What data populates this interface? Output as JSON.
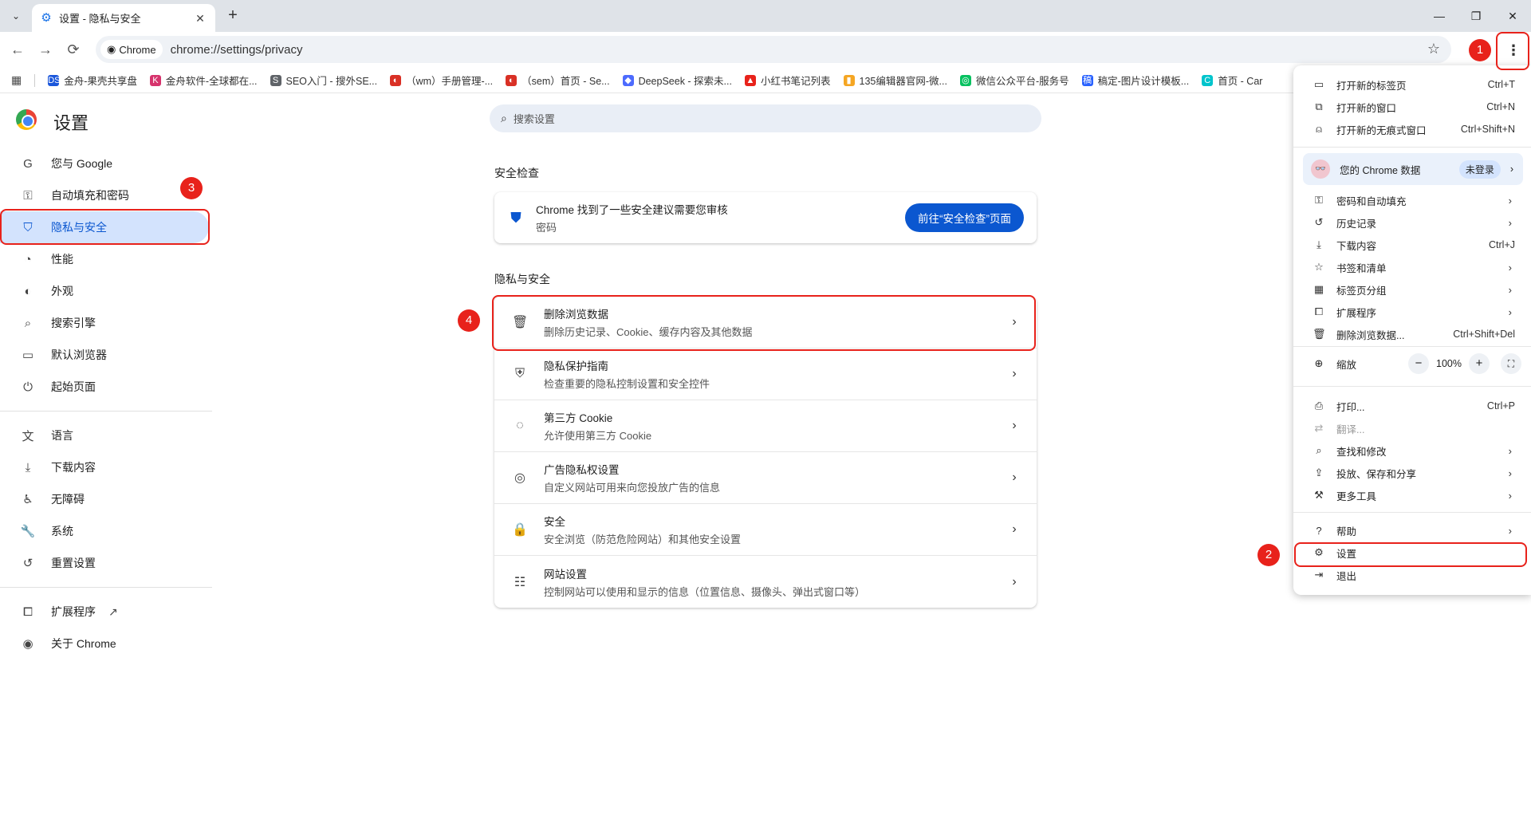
{
  "tab": {
    "title": "设置 - 隐私与安全",
    "close": "✕"
  },
  "window": {
    "minimize": "—",
    "restore": "❐",
    "close": "✕"
  },
  "toolbar": {
    "back": "←",
    "forward": "→",
    "reload": "⟳",
    "chip_label": "Chrome",
    "url": "chrome://settings/privacy",
    "star": "☆",
    "menu": "⋮"
  },
  "bookmarks": [
    {
      "label": "金舟-果壳共享盘",
      "icon": "DSK",
      "color": "#1a56db"
    },
    {
      "label": "金舟软件-全球都在...",
      "icon": "K",
      "color": "#d6336c"
    },
    {
      "label": "SEO入门 - 搜外SE...",
      "icon": "S",
      "color": "#5f6368"
    },
    {
      "label": "（wm）手册管理-...",
      "icon": "◐",
      "color": "#d93025"
    },
    {
      "label": "（sem）首页 - Se...",
      "icon": "◐",
      "color": "#d93025"
    },
    {
      "label": "DeepSeek - 探索未...",
      "icon": "◆",
      "color": "#4d6bfe"
    },
    {
      "label": "小红书笔记列表",
      "icon": "▲",
      "color": "#e8221b"
    },
    {
      "label": "135编辑器官网-微...",
      "icon": "▮",
      "color": "#f5a623"
    },
    {
      "label": "微信公众平台-服务号",
      "icon": "◎",
      "color": "#07c160"
    },
    {
      "label": "稿定-图片设计模板...",
      "icon": "稿",
      "color": "#2962ff"
    },
    {
      "label": "首页 - Car",
      "icon": "C",
      "color": "#00c4cc"
    }
  ],
  "settings": {
    "title": "设置"
  },
  "nav": {
    "items": [
      {
        "label": "您与 Google",
        "icon": "G",
        "name": "google"
      },
      {
        "label": "自动填充和密码",
        "icon": "⚿",
        "name": "autofill"
      },
      {
        "label": "隐私与安全",
        "icon": "⛉",
        "name": "privacy"
      },
      {
        "label": "性能",
        "icon": "◔",
        "name": "performance"
      },
      {
        "label": "外观",
        "icon": "◐",
        "name": "appearance"
      },
      {
        "label": "搜索引擎",
        "icon": "⌕",
        "name": "search-engine"
      },
      {
        "label": "默认浏览器",
        "icon": "▭",
        "name": "default-browser"
      },
      {
        "label": "起始页面",
        "icon": "⏻",
        "name": "on-startup"
      }
    ],
    "items2": [
      {
        "label": "语言",
        "icon": "文",
        "name": "languages"
      },
      {
        "label": "下载内容",
        "icon": "⤓",
        "name": "downloads"
      },
      {
        "label": "无障碍",
        "icon": "♿",
        "name": "accessibility"
      },
      {
        "label": "系统",
        "icon": "🔧",
        "name": "system"
      },
      {
        "label": "重置设置",
        "icon": "↺",
        "name": "reset"
      }
    ],
    "extensions": "扩展程序",
    "about": "关于 Chrome"
  },
  "search": {
    "placeholder": "搜索设置"
  },
  "safety": {
    "section": "安全检查",
    "title": "Chrome 找到了一些安全建议需要您审核",
    "sub": "密码",
    "button": "前往“安全检查”页面"
  },
  "privacy": {
    "section": "隐私与安全",
    "rows": [
      {
        "title": "删除浏览数据",
        "sub": "删除历史记录、Cookie、缓存内容及其他数据",
        "icon": "🗑"
      },
      {
        "title": "隐私保护指南",
        "sub": "检查重要的隐私控制设置和安全控件",
        "icon": "⛨"
      },
      {
        "title": "第三方 Cookie",
        "sub": "允许使用第三方 Cookie",
        "icon": "◌"
      },
      {
        "title": "广告隐私权设置",
        "sub": "自定义网站可用来向您投放广告的信息",
        "icon": "◎"
      },
      {
        "title": "安全",
        "sub": "安全浏览（防范危险网站）和其他安全设置",
        "icon": "🔒"
      },
      {
        "title": "网站设置",
        "sub": "控制网站可以使用和显示的信息（位置信息、摄像头、弹出式窗口等）",
        "icon": "☷"
      }
    ]
  },
  "menu": {
    "top": [
      {
        "label": "打开新的标签页",
        "short": "Ctrl+T",
        "icon": "▭"
      },
      {
        "label": "打开新的窗口",
        "short": "Ctrl+N",
        "icon": "⧉"
      },
      {
        "label": "打开新的无痕式窗口",
        "short": "Ctrl+Shift+N",
        "icon": "⍝"
      }
    ],
    "profile": {
      "label": "您的 Chrome 数据",
      "badge": "未登录",
      "avatar": "👓"
    },
    "mid": [
      {
        "label": "密码和自动填充",
        "icon": "⚿"
      },
      {
        "label": "历史记录",
        "icon": "↺"
      },
      {
        "label": "下载内容",
        "short": "Ctrl+J",
        "icon": "⤓"
      },
      {
        "label": "书签和清单",
        "icon": "☆"
      },
      {
        "label": "标签页分组",
        "icon": "▦"
      },
      {
        "label": "扩展程序",
        "icon": "⧠"
      },
      {
        "label": "删除浏览数据...",
        "short": "Ctrl+Shift+Del",
        "icon": "🗑"
      }
    ],
    "zoom": {
      "label": "缩放",
      "minus": "−",
      "value": "100%",
      "plus": "+",
      "fullscreen": "⛶"
    },
    "tools": [
      {
        "label": "打印...",
        "short": "Ctrl+P",
        "icon": "⎙"
      },
      {
        "label": "翻译...",
        "icon": "⇄",
        "disabled": true
      },
      {
        "label": "查找和修改",
        "icon": "⌕"
      },
      {
        "label": "投放、保存和分享",
        "icon": "⇪"
      },
      {
        "label": "更多工具",
        "icon": "⚒"
      }
    ],
    "bottom": [
      {
        "label": "帮助",
        "icon": "?"
      },
      {
        "label": "设置",
        "icon": "⚙"
      },
      {
        "label": "退出",
        "icon": "⇥"
      }
    ]
  },
  "annotations": [
    "1",
    "2",
    "3",
    "4"
  ],
  "colors": {
    "accent": "#0b57d0",
    "annotation": "#e8221b",
    "active_nav_bg": "#d3e3fd"
  }
}
